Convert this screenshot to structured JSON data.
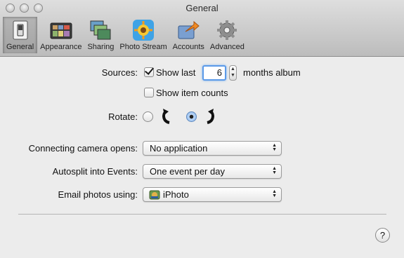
{
  "window": {
    "title": "General"
  },
  "toolbar": {
    "tabs": [
      {
        "label": "General",
        "icon": "general-switch-icon",
        "active": true
      },
      {
        "label": "Appearance",
        "icon": "appearance-icon",
        "active": false
      },
      {
        "label": "Sharing",
        "icon": "sharing-icon",
        "active": false
      },
      {
        "label": "Photo Stream",
        "icon": "photo-stream-icon",
        "active": false
      },
      {
        "label": "Accounts",
        "icon": "accounts-icon",
        "active": false
      },
      {
        "label": "Advanced",
        "icon": "gear-icon",
        "active": false
      }
    ]
  },
  "sources": {
    "label": "Sources:",
    "show_last_label": "Show last",
    "show_last_checked": true,
    "months_value": "6",
    "months_suffix": "months album",
    "show_counts_label": "Show item counts",
    "show_counts_checked": false
  },
  "rotate": {
    "label": "Rotate:",
    "options": [
      {
        "icon": "rotate-counterclockwise-icon",
        "selected": false
      },
      {
        "icon": "rotate-clockwise-icon",
        "selected": true
      }
    ]
  },
  "connecting_camera": {
    "label": "Connecting camera opens:",
    "value": "No application"
  },
  "autosplit": {
    "label": "Autosplit into Events:",
    "value": "One event per day"
  },
  "email": {
    "label": "Email photos using:",
    "value": "iPhoto"
  },
  "help": {
    "label": "?"
  },
  "colors": {
    "focus_ring": "#5b9ae8",
    "toolbar_top": "#dedede",
    "toolbar_bottom": "#bcbcbc"
  }
}
